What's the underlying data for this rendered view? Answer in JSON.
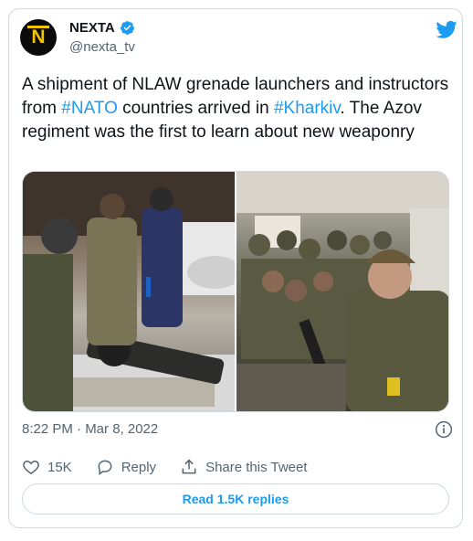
{
  "author": {
    "display_name": "NEXTA",
    "handle": "@nexta_tv",
    "avatar_letter": "N"
  },
  "tweet": {
    "segments": [
      {
        "text": "A shipment of NLAW grenade launchers and instructors from ",
        "type": "text"
      },
      {
        "text": "#NATO",
        "type": "hashtag"
      },
      {
        "text": " countries arrived in ",
        "type": "text"
      },
      {
        "text": "#Kharkiv",
        "type": "hashtag"
      },
      {
        "text": ". The Azov regiment was the first to learn about new weaponry",
        "type": "text"
      }
    ]
  },
  "meta": {
    "timestamp": "8:22 PM · Mar 8, 2022"
  },
  "actions": {
    "likes_count": "15K",
    "reply_label": "Reply",
    "share_label": "Share this Tweet"
  },
  "footer": {
    "read_replies_label": "Read 1.5K replies"
  },
  "colors": {
    "accent": "#1d9bf0",
    "text": "#0f1419",
    "muted": "#536471",
    "border": "#cfd9de"
  },
  "icons": [
    "verified-badge-icon",
    "twitter-bird-icon",
    "info-icon",
    "heart-icon",
    "reply-icon",
    "share-icon"
  ]
}
